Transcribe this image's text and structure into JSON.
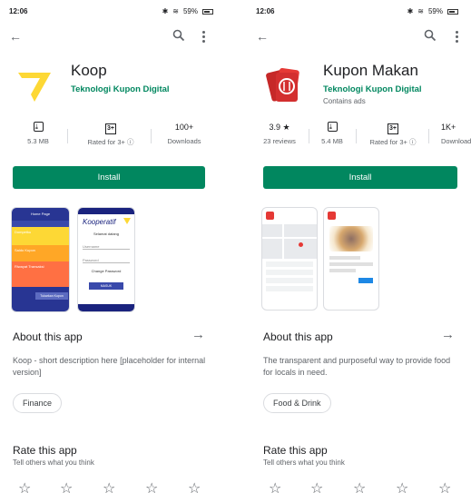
{
  "left": {
    "status": {
      "time": "12:06",
      "battery": "59%"
    },
    "app": {
      "title": "Koop",
      "developer": "Teknologi Kupon Digital"
    },
    "stats": [
      {
        "top": "",
        "bottom": "5.3 MB",
        "icon": "download-icon"
      },
      {
        "top": "3+",
        "bottom": "Rated for 3+ ⓘ",
        "icon": "rating-icon"
      },
      {
        "top": "100+",
        "bottom": "Downloads"
      }
    ],
    "install_label": "Install",
    "screenshots": {
      "shot1": {
        "header": "Home Page",
        "items": [
          "Dompetku",
          "Saldo Kupon",
          "Riwayat Transaksi",
          "Pengaturan"
        ],
        "button": "Tukarkan Kupon"
      },
      "shot2": {
        "brand": "Kooperatif",
        "title": "Selamat datang",
        "field1": "Username",
        "field2": "Password",
        "link": "Change Password",
        "button": "MASUK"
      }
    },
    "about": {
      "title": "About this app",
      "desc": "Koop - short description here [placeholder for internal version]"
    },
    "category": "Finance",
    "rate": {
      "title": "Rate this app",
      "subtitle": "Tell others what you think"
    }
  },
  "right": {
    "status": {
      "time": "12:06",
      "battery": "59%"
    },
    "app": {
      "title": "Kupon Makan",
      "developer": "Teknologi Kupon Digital",
      "ads": "Contains ads"
    },
    "stats": [
      {
        "top": "3.9 ★",
        "bottom": "23 reviews"
      },
      {
        "top": "",
        "bottom": "5.4 MB",
        "icon": "download-icon"
      },
      {
        "top": "3+",
        "bottom": "Rated for 3+ ⓘ",
        "icon": "rating-icon"
      },
      {
        "top": "1K+",
        "bottom": "Downloads"
      }
    ],
    "install_label": "Install",
    "about": {
      "title": "About this app",
      "desc": "The transparent and purposeful way to provide food for locals in need."
    },
    "category": "Food & Drink",
    "rate": {
      "title": "Rate this app",
      "subtitle": "Tell others what you think"
    }
  },
  "colors": {
    "play_green": "#01875f",
    "koop_yellow": "#fdd835",
    "kupon_red": "#e53935",
    "koop_orange": "#ff7043"
  }
}
